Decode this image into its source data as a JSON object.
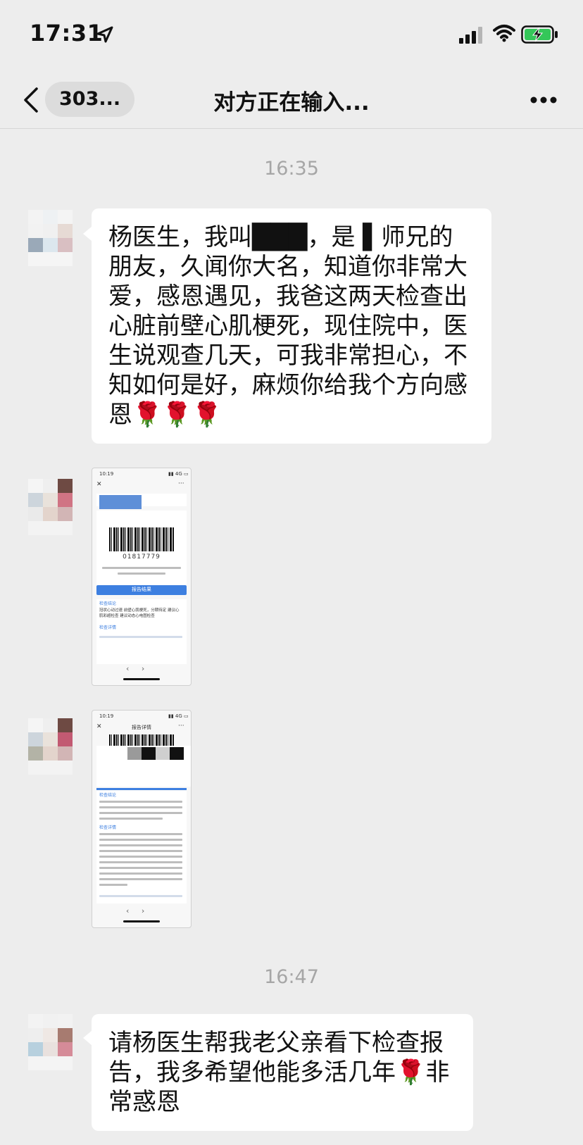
{
  "status_bar": {
    "time": "17:31"
  },
  "nav": {
    "back_label": "303...",
    "title": "对方正在输入..."
  },
  "messages": [
    {
      "time": "16:35",
      "text": "杨医生，我叫███，是 ▌师兄的朋友，久闻你大名，知道你非常大爱，感恩遇见，我爸这两天检查出心脏前壁心肌梗死，现住院中，医生说观查几天，可我非常担心，不知如何是好，麻烦你给我个方向感恩🌹🌹🌹"
    },
    {
      "image": "report-screenshot-1"
    },
    {
      "image": "report-screenshot-2"
    },
    {
      "time": "16:47",
      "text": "请杨医生帮我老父亲看下检查报告，我多希望他能多活几年🌹非常惑恩"
    }
  ],
  "screenshot1": {
    "status_time": "10:19",
    "barcode_number": "01817779",
    "button_label": "报告结果",
    "section_label": "检查结论",
    "conclusion": "冠状心动过速 前壁心肌梗死，分期待定 建议心肌彩超检查 建议动态心电图检查",
    "detail_label": "检查详情"
  },
  "screenshot2": {
    "status_time": "10:19",
    "header_title": "报告详情",
    "section_label": "检查结论",
    "detail_label": "检查详情"
  }
}
